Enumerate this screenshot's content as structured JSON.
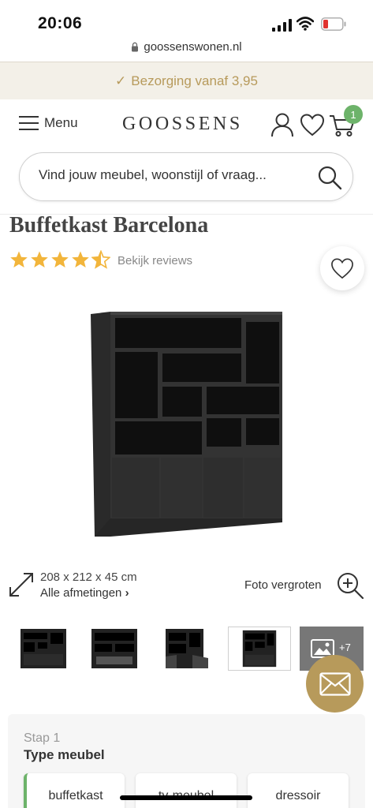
{
  "status_bar": {
    "time": "20:06"
  },
  "browser": {
    "url": "goossenswonen.nl"
  },
  "promo": {
    "check_glyph": "✓",
    "text": "Bezorging vanaf 3,95"
  },
  "header": {
    "menu_label": "Menu",
    "logo": "GOOSSENS",
    "cart_count": "1",
    "icons": [
      "hamburger-icon",
      "user-icon",
      "heart-icon",
      "cart-icon"
    ]
  },
  "search": {
    "placeholder": "Vind jouw meubel, woonstijl of vraag..."
  },
  "product": {
    "title": "Buffetkast Barcelona",
    "rating": 4.5,
    "rating_max": 5,
    "reviews_link": "Bekijk reviews",
    "dimensions": "208 x 212 x 45 cm",
    "all_dimensions": "Alle afmetingen",
    "all_dimensions_chevron": "›",
    "photo_enlarge": "Foto vergroten",
    "more_photos": "+7"
  },
  "configurator": {
    "step": "Stap 1",
    "title": "Type meubel",
    "options": [
      "buffetkast",
      "tv-meubel",
      "dressoir"
    ],
    "selected": "buffetkast"
  },
  "colors": {
    "accent_gold": "#b79a5b",
    "promo_bg": "#f3f0e8",
    "badge_green": "#6db36a",
    "star": "#f2b53b"
  }
}
